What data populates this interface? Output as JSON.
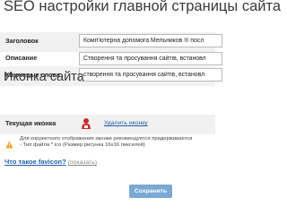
{
  "seo_section": {
    "title": "SEO настройки главной страницы сайта",
    "fields": [
      {
        "label": "Заголовок",
        "value": "Комп'ютерна допомога Мельников ® посл"
      },
      {
        "label": "Описание",
        "value": "Створення та просування сайтів, встановл"
      },
      {
        "label": "Ключевые слова",
        "value": "створення та просування сайтів, встановл"
      }
    ]
  },
  "icon_section": {
    "title": "Иконка сайта",
    "current_label": "Текущая иконка",
    "delete_link": "Удалить иконку",
    "warning_line_1": "Для корректного отображения иконки рекомендуется придерживается",
    "warning_line_2": "- Тип файла *.ico (Размер рисунка 16x16 пикселей)",
    "help_question": "Что такое favicon?",
    "help_toggle": "(показать)"
  },
  "actions": {
    "save_label": "Сохранить",
    "save_color": "#7aa9d3",
    "link_color": "#1f5fa8",
    "warning_color": "#f0a020"
  }
}
